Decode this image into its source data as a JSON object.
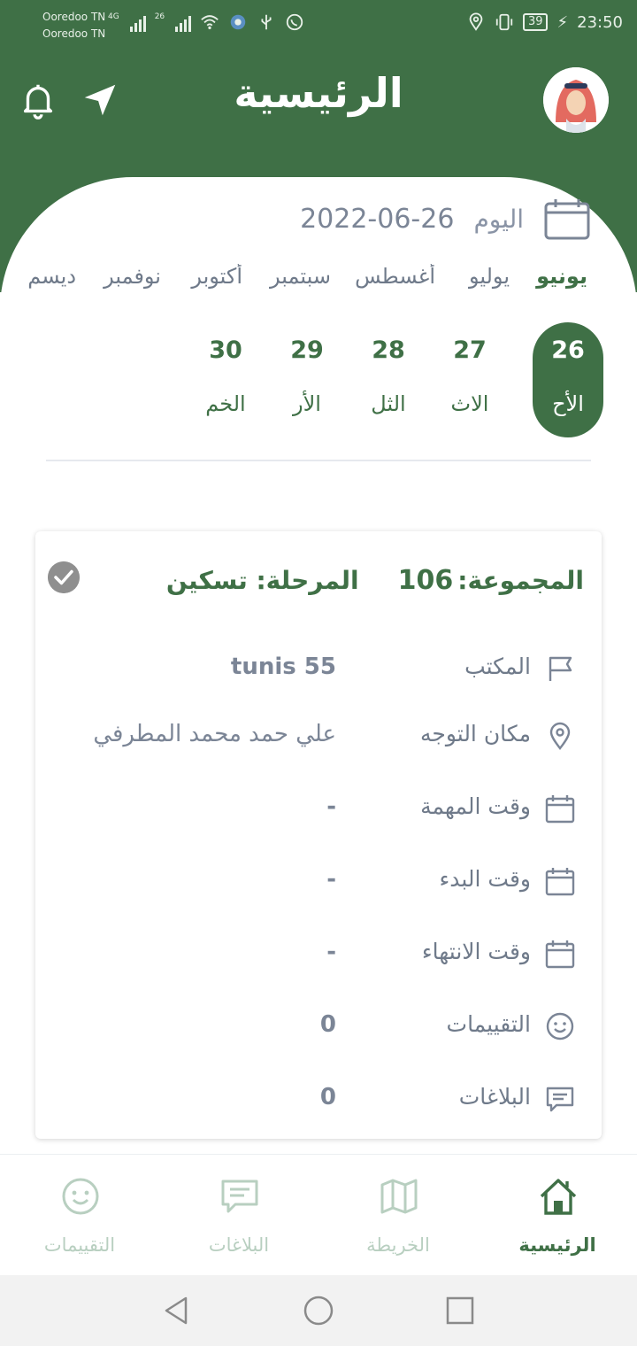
{
  "status_bar": {
    "carrier_1": "Ooredoo TN",
    "carrier_2": "Ooredoo TN",
    "net_1": "4G",
    "net_2": "26",
    "battery": "39",
    "time": "23:50"
  },
  "header": {
    "title": "الرئيسية",
    "bell_icon": "bell-icon",
    "navigate_icon": "navigation-arrow-icon",
    "avatar_icon": "user-avatar"
  },
  "date_bar": {
    "today_label": "اليوم",
    "today_date": "2022-06-26",
    "calendar_icon": "calendar-icon"
  },
  "months": {
    "items": [
      "يونيو",
      "يوليو",
      "أغسطس",
      "سبتمبر",
      "أكتوبر",
      "نوفمبر",
      "ديسم"
    ],
    "selected": "يونيو"
  },
  "days": {
    "items": [
      {
        "num": "26",
        "weekday": "الأح"
      },
      {
        "num": "27",
        "weekday": "الاث"
      },
      {
        "num": "28",
        "weekday": "الثل"
      },
      {
        "num": "29",
        "weekday": "الأر"
      },
      {
        "num": "30",
        "weekday": "الخم"
      }
    ],
    "selected": "26"
  },
  "task": {
    "group_label": "المجموعة:",
    "group_value": "106",
    "stage_text": "المرحلة: تسكين",
    "rows": [
      {
        "icon": "flag-icon",
        "label": "المكتب",
        "value": "tunis 55"
      },
      {
        "icon": "location-pin-icon",
        "label": "مكان التوجه",
        "value": "علي حمد محمد المطرفي"
      },
      {
        "icon": "calendar-icon",
        "label": "وقت المهمة",
        "value": "-"
      },
      {
        "icon": "calendar-icon",
        "label": "وقت البدء",
        "value": "-"
      },
      {
        "icon": "calendar-icon",
        "label": "وقت الانتهاء",
        "value": "-"
      },
      {
        "icon": "smiley-icon",
        "label": "التقييمات",
        "value": "0"
      },
      {
        "icon": "comment-icon",
        "label": "البلاغات",
        "value": "0"
      }
    ]
  },
  "bottom_nav": {
    "items": [
      {
        "label": "الرئيسية",
        "icon": "home-icon"
      },
      {
        "label": "الخريطة",
        "icon": "map-icon"
      },
      {
        "label": "البلاغات",
        "icon": "comment-icon"
      },
      {
        "label": "التقييمات",
        "icon": "smiley-icon"
      }
    ],
    "selected": "الرئيسية"
  },
  "colors": {
    "primary_green": "#3f7046",
    "muted_text": "#6f7a8a",
    "inactive_nav": "#b8cfc0"
  }
}
